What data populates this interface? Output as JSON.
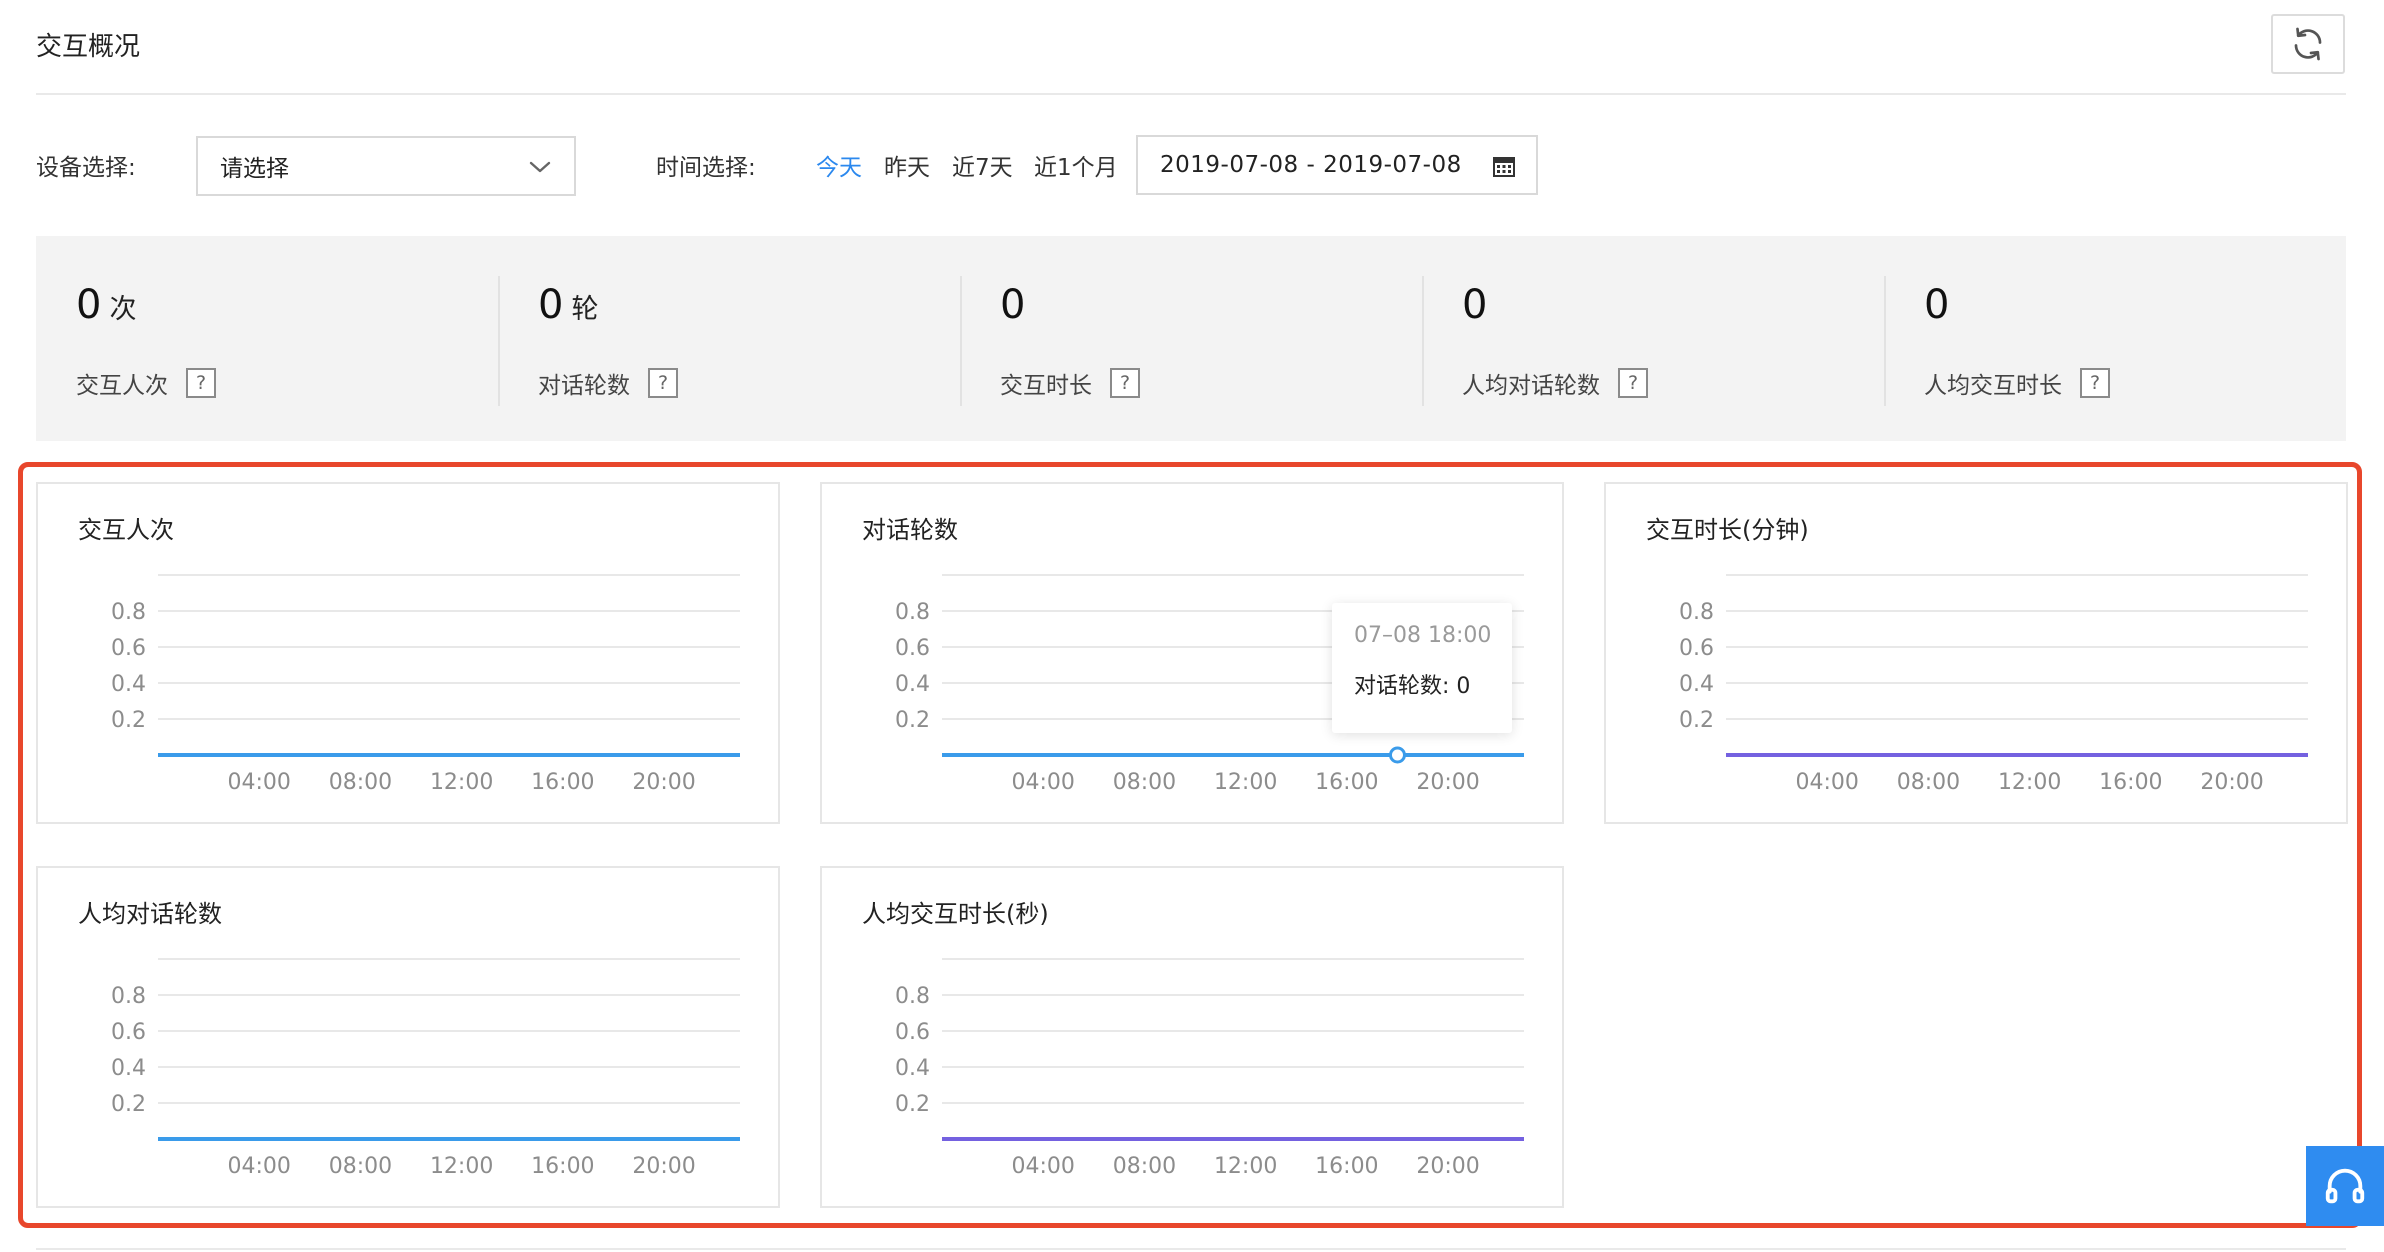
{
  "header": {
    "title": "交互概况"
  },
  "filters": {
    "device_label": "设备选择:",
    "device_value": "请选择",
    "time_label": "时间选择:",
    "time_options": [
      "今天",
      "昨天",
      "近7天",
      "近1个月"
    ],
    "active_time_option": "今天",
    "date_range": "2019-07-08 - 2019-07-08"
  },
  "stats": [
    {
      "value": "0",
      "unit": "次",
      "label": "交互人次"
    },
    {
      "value": "0",
      "unit": "轮",
      "label": "对话轮数"
    },
    {
      "value": "0",
      "unit": "",
      "label": "交互时长"
    },
    {
      "value": "0",
      "unit": "",
      "label": "人均对话轮数"
    },
    {
      "value": "0",
      "unit": "",
      "label": "人均交互时长"
    }
  ],
  "help_glyph": "?",
  "colors": {
    "accent_blue": "#2b88ee",
    "line_blue": "#3a9bea",
    "line_purple": "#7461e0",
    "highlight_red": "#e8472c"
  },
  "tooltip": {
    "time": "07–08 18:00",
    "series_label": "对话轮数:",
    "value": "0"
  },
  "chart_data": [
    {
      "type": "line",
      "title": "交互人次",
      "x": [
        "00:00",
        "01:00",
        "02:00",
        "03:00",
        "04:00",
        "05:00",
        "06:00",
        "07:00",
        "08:00",
        "09:00",
        "10:00",
        "11:00",
        "12:00",
        "13:00",
        "14:00",
        "15:00",
        "16:00",
        "17:00",
        "18:00",
        "19:00",
        "20:00",
        "21:00",
        "22:00",
        "23:00"
      ],
      "x_tick_labels": [
        "04:00",
        "08:00",
        "12:00",
        "16:00",
        "20:00"
      ],
      "y_tick_labels": [
        "0.8",
        "0.6",
        "0.4",
        "0.2"
      ],
      "ylim": [
        0,
        1
      ],
      "grid": true,
      "line_color": "#3a9bea",
      "values": [
        0,
        0,
        0,
        0,
        0,
        0,
        0,
        0,
        0,
        0,
        0,
        0,
        0,
        0,
        0,
        0,
        0,
        0,
        0,
        0,
        0,
        0,
        0,
        0
      ]
    },
    {
      "type": "line",
      "title": "对话轮数",
      "x": [
        "00:00",
        "01:00",
        "02:00",
        "03:00",
        "04:00",
        "05:00",
        "06:00",
        "07:00",
        "08:00",
        "09:00",
        "10:00",
        "11:00",
        "12:00",
        "13:00",
        "14:00",
        "15:00",
        "16:00",
        "17:00",
        "18:00",
        "19:00",
        "20:00",
        "21:00",
        "22:00",
        "23:00"
      ],
      "x_tick_labels": [
        "04:00",
        "08:00",
        "12:00",
        "16:00",
        "20:00"
      ],
      "y_tick_labels": [
        "0.8",
        "0.6",
        "0.4",
        "0.2"
      ],
      "ylim": [
        0,
        1
      ],
      "grid": true,
      "line_color": "#3a9bea",
      "values": [
        0,
        0,
        0,
        0,
        0,
        0,
        0,
        0,
        0,
        0,
        0,
        0,
        0,
        0,
        0,
        0,
        0,
        0,
        0,
        0,
        0,
        0,
        0,
        0
      ],
      "highlighted_point": "18:00"
    },
    {
      "type": "line",
      "title": "交互时长(分钟)",
      "x": [
        "00:00",
        "01:00",
        "02:00",
        "03:00",
        "04:00",
        "05:00",
        "06:00",
        "07:00",
        "08:00",
        "09:00",
        "10:00",
        "11:00",
        "12:00",
        "13:00",
        "14:00",
        "15:00",
        "16:00",
        "17:00",
        "18:00",
        "19:00",
        "20:00",
        "21:00",
        "22:00",
        "23:00"
      ],
      "x_tick_labels": [
        "04:00",
        "08:00",
        "12:00",
        "16:00",
        "20:00"
      ],
      "y_tick_labels": [
        "0.8",
        "0.6",
        "0.4",
        "0.2"
      ],
      "ylim": [
        0,
        1
      ],
      "grid": true,
      "line_color": "#7461e0",
      "values": [
        0,
        0,
        0,
        0,
        0,
        0,
        0,
        0,
        0,
        0,
        0,
        0,
        0,
        0,
        0,
        0,
        0,
        0,
        0,
        0,
        0,
        0,
        0,
        0
      ]
    },
    {
      "type": "line",
      "title": "人均对话轮数",
      "x": [
        "00:00",
        "01:00",
        "02:00",
        "03:00",
        "04:00",
        "05:00",
        "06:00",
        "07:00",
        "08:00",
        "09:00",
        "10:00",
        "11:00",
        "12:00",
        "13:00",
        "14:00",
        "15:00",
        "16:00",
        "17:00",
        "18:00",
        "19:00",
        "20:00",
        "21:00",
        "22:00",
        "23:00"
      ],
      "x_tick_labels": [
        "04:00",
        "08:00",
        "12:00",
        "16:00",
        "20:00"
      ],
      "y_tick_labels": [
        "0.8",
        "0.6",
        "0.4",
        "0.2"
      ],
      "ylim": [
        0,
        1
      ],
      "grid": true,
      "line_color": "#3a9bea",
      "values": [
        0,
        0,
        0,
        0,
        0,
        0,
        0,
        0,
        0,
        0,
        0,
        0,
        0,
        0,
        0,
        0,
        0,
        0,
        0,
        0,
        0,
        0,
        0,
        0
      ]
    },
    {
      "type": "line",
      "title": "人均交互时长(秒)",
      "x": [
        "00:00",
        "01:00",
        "02:00",
        "03:00",
        "04:00",
        "05:00",
        "06:00",
        "07:00",
        "08:00",
        "09:00",
        "10:00",
        "11:00",
        "12:00",
        "13:00",
        "14:00",
        "15:00",
        "16:00",
        "17:00",
        "18:00",
        "19:00",
        "20:00",
        "21:00",
        "22:00",
        "23:00"
      ],
      "x_tick_labels": [
        "04:00",
        "08:00",
        "12:00",
        "16:00",
        "20:00"
      ],
      "y_tick_labels": [
        "0.8",
        "0.6",
        "0.4",
        "0.2"
      ],
      "ylim": [
        0,
        1
      ],
      "grid": true,
      "line_color": "#7461e0",
      "values": [
        0,
        0,
        0,
        0,
        0,
        0,
        0,
        0,
        0,
        0,
        0,
        0,
        0,
        0,
        0,
        0,
        0,
        0,
        0,
        0,
        0,
        0,
        0,
        0
      ]
    }
  ]
}
